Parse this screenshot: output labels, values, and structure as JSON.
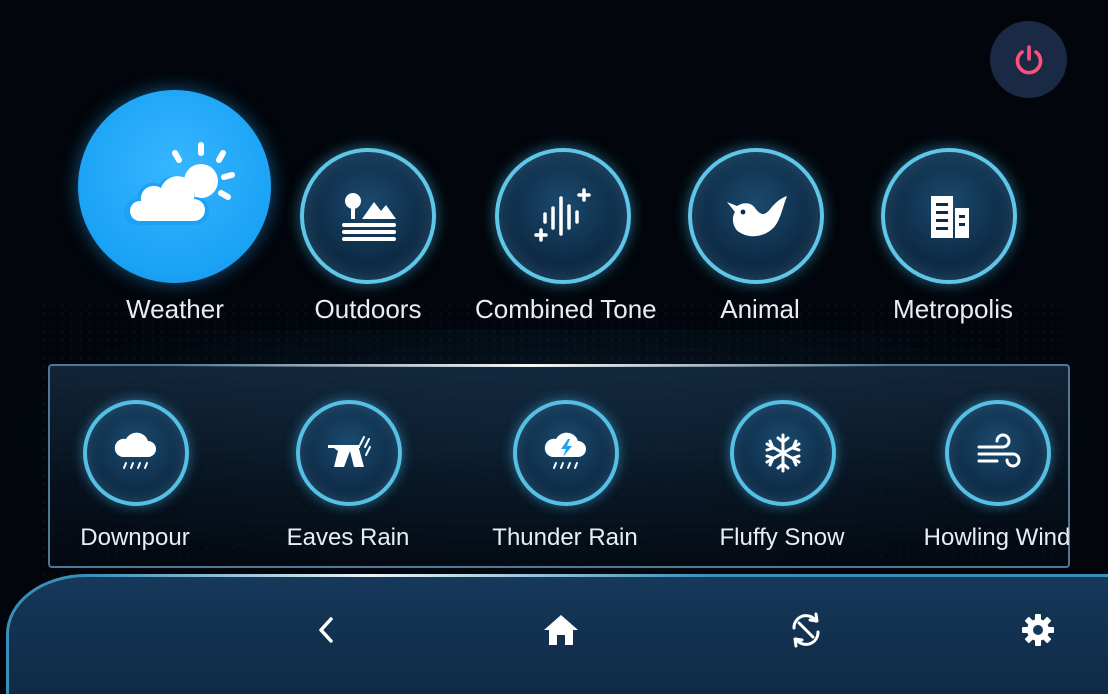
{
  "header": {
    "power_icon": "power-icon",
    "power_color": "#ff4f7b"
  },
  "categories": [
    {
      "label": "Weather",
      "icon": "weather-cloud-sun-icon",
      "active": true
    },
    {
      "label": "Outdoors",
      "icon": "outdoors-landscape-icon",
      "active": false
    },
    {
      "label": "Combined Tone",
      "icon": "combined-tone-waveform-icon",
      "active": false
    },
    {
      "label": "Animal",
      "icon": "bird-icon",
      "active": false
    },
    {
      "label": "Metropolis",
      "icon": "building-icon",
      "active": false
    }
  ],
  "sounds": [
    {
      "label": "Downpour",
      "icon": "rain-cloud-icon"
    },
    {
      "label": "Eaves Rain",
      "icon": "eaves-rain-icon"
    },
    {
      "label": "Thunder Rain",
      "icon": "thunder-rain-icon"
    },
    {
      "label": "Fluffy Snow",
      "icon": "snowflake-icon"
    },
    {
      "label": "Howling Wind",
      "icon": "wind-icon"
    }
  ],
  "navbar": {
    "back_icon": "chevron-left-icon",
    "home_icon": "home-icon",
    "loop_icon": "loop-sync-icon",
    "settings_icon": "gear-icon"
  },
  "colors": {
    "accent": "#1aa2f5",
    "ring": "#5fc6e8",
    "background": "#02060c",
    "navbar": "#16385a"
  }
}
